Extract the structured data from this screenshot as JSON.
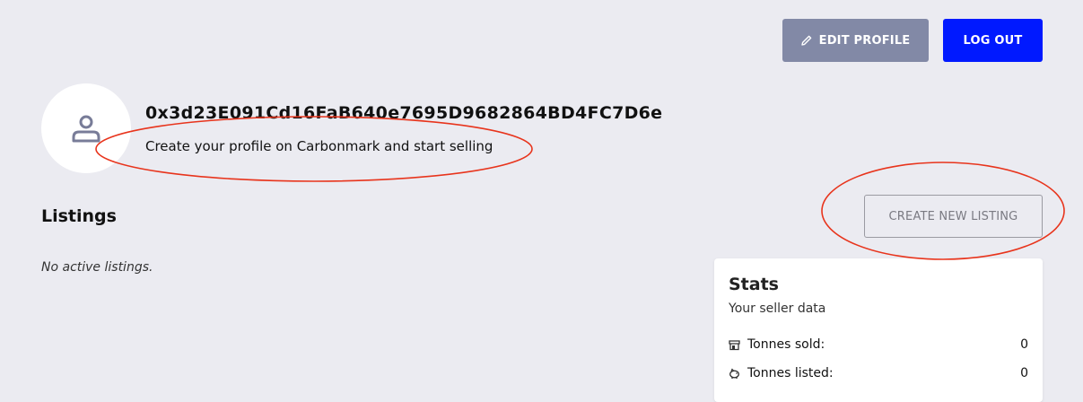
{
  "header": {
    "edit_profile_label": "EDIT PROFILE",
    "logout_label": "LOG OUT"
  },
  "profile": {
    "wallet_address": "0x3d23E091Cd16FaB640e7695D9682864BD4FC7D6e",
    "subtitle": "Create your profile on Carbonmark and start selling",
    "avatar_icon": "user-icon"
  },
  "listings": {
    "heading": "Listings",
    "empty_text": "No active listings.",
    "create_label": "CREATE NEW LISTING"
  },
  "stats": {
    "title": "Stats",
    "subtitle": "Your seller data",
    "rows": [
      {
        "icon": "store-icon",
        "label": "Tonnes sold:",
        "value": "0"
      },
      {
        "icon": "piggy-bank-icon",
        "label": "Tonnes listed:",
        "value": "0"
      }
    ]
  },
  "colors": {
    "background": "#ebebf1",
    "edit_button": "#8289a6",
    "logout_button": "#0019ff",
    "annotation": "#e8341c"
  }
}
